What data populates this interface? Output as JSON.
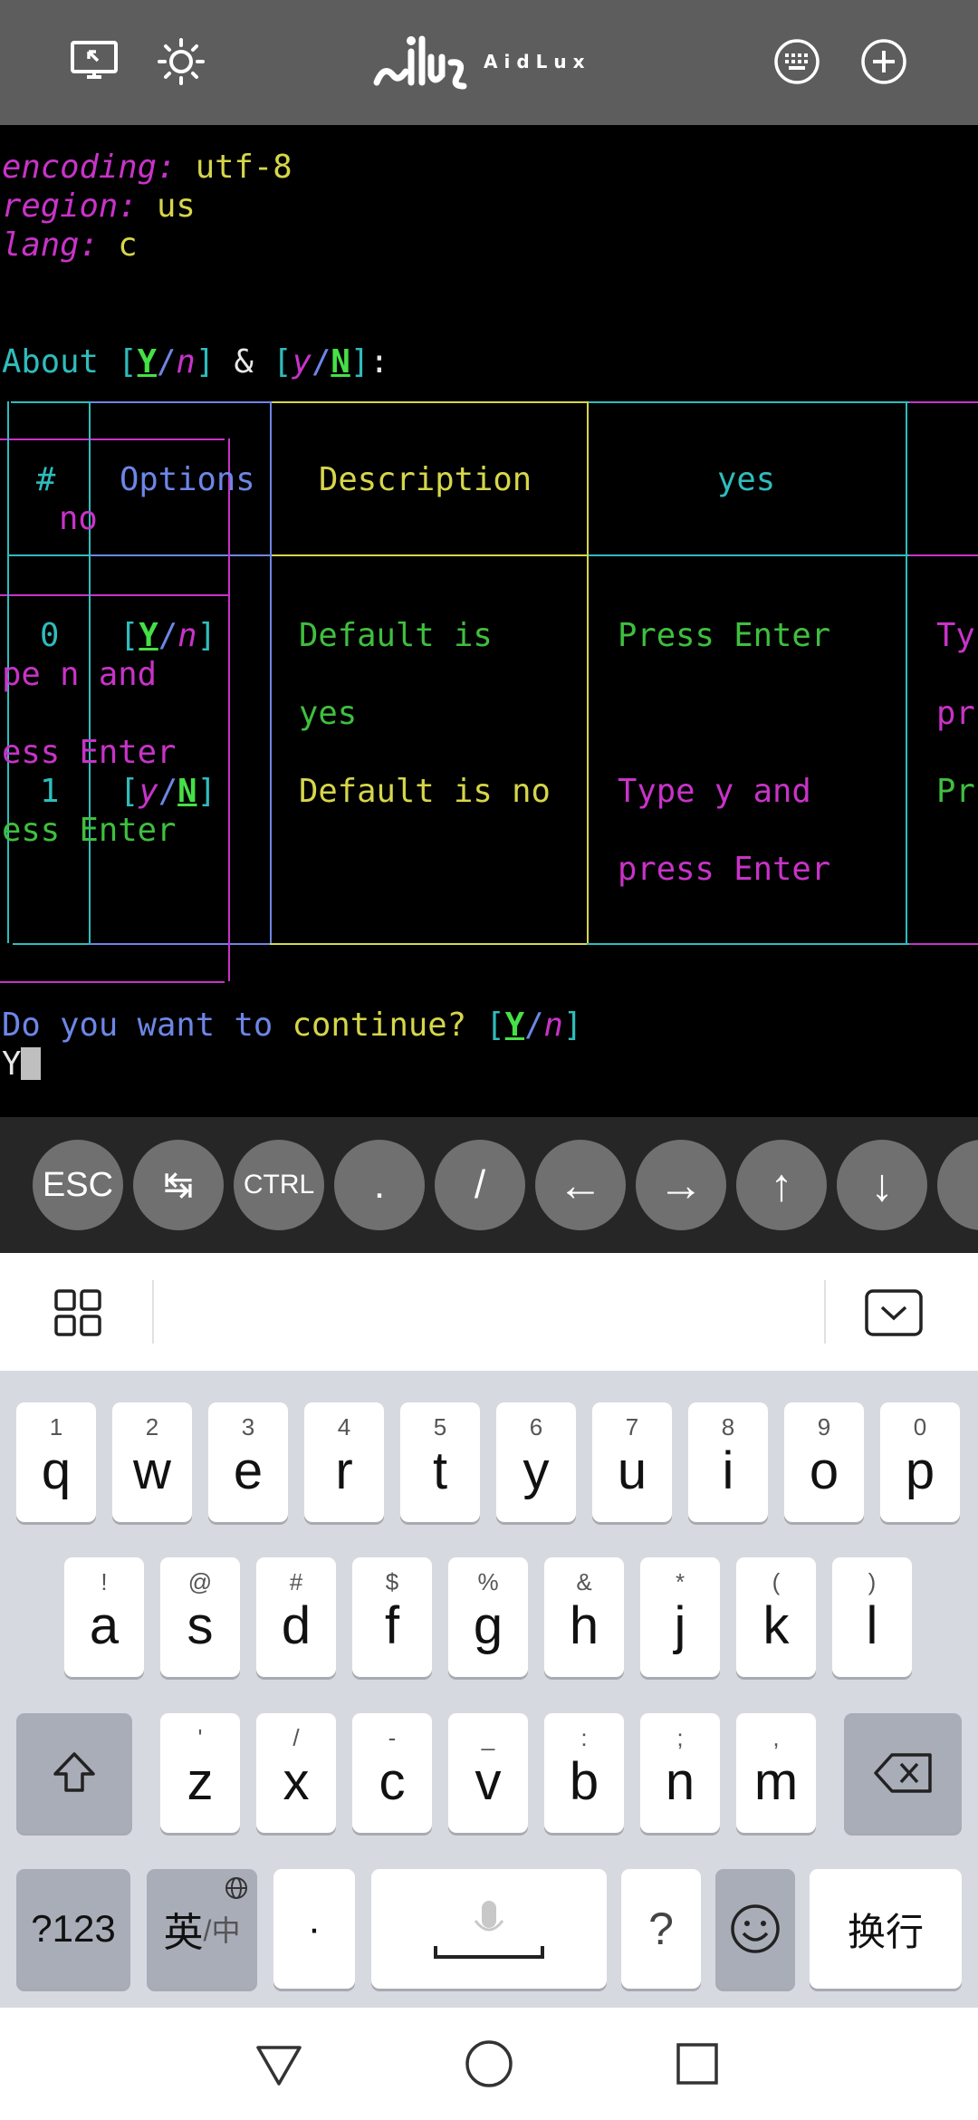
{
  "app": {
    "brand": "AidLux",
    "icons": {
      "screen": "screen-cast-icon",
      "brightness": "brightness-icon",
      "keyboard": "keyboard-icon",
      "add": "add-circle-icon"
    }
  },
  "terminal": {
    "config": [
      {
        "key": "encoding:",
        "value": "utf-8"
      },
      {
        "key": "region:",
        "value": "us"
      },
      {
        "key": "lang:",
        "value": "c"
      }
    ],
    "about": {
      "label": "About ",
      "yes_default": {
        "o": "[",
        "Y": "Y",
        "sep": "/",
        "n": "n",
        "c": "]"
      },
      "amp": " & ",
      "no_default": {
        "o": "[",
        "y": "y",
        "sep": "/",
        "N": "N",
        "c": "]"
      },
      "colon": ":"
    },
    "table": {
      "headers": [
        "#",
        "Options",
        "Description",
        "yes",
        "no"
      ],
      "rows": [
        {
          "num": "0",
          "opt": {
            "o": "[",
            "a": "Y",
            "sep": "/",
            "b": "n",
            "c": "]"
          },
          "desc": [
            "Default is",
            "yes"
          ],
          "yes": [],
          "yes_text": "Press Enter",
          "no_parts": [
            "Ty",
            "pe n and",
            "pr",
            "ess Enter"
          ]
        },
        {
          "num": "1",
          "opt": {
            "o": "[",
            "a": "y",
            "sep": "/",
            "b": "N",
            "c": "]"
          },
          "desc": [
            "Default is no"
          ],
          "yes_text": "Type y and",
          "yes_text2": "press Enter",
          "no_parts": [
            "Pr",
            "ess Enter"
          ]
        }
      ]
    },
    "prompt": {
      "w1": "Do you want to ",
      "w2": "continue? ",
      "o": "[",
      "Y": "Y",
      "sep": "/",
      "n": "n",
      "c": "]"
    },
    "input": "Y"
  },
  "extra_keys": [
    {
      "label": "ESC",
      "name": "esc-key"
    },
    {
      "label": "↹",
      "name": "tab-key"
    },
    {
      "label": "CTRL",
      "name": "ctrl-key"
    },
    {
      "label": ".",
      "name": "period-key"
    },
    {
      "label": "/",
      "name": "slash-key"
    },
    {
      "label": "←",
      "name": "arrow-left-key"
    },
    {
      "label": "→",
      "name": "arrow-right-key"
    },
    {
      "label": "↑",
      "name": "arrow-up-key"
    },
    {
      "label": "↓",
      "name": "arrow-down-key"
    }
  ],
  "keyboard": {
    "row1": [
      {
        "main": "q",
        "sub": "1"
      },
      {
        "main": "w",
        "sub": "2"
      },
      {
        "main": "e",
        "sub": "3"
      },
      {
        "main": "r",
        "sub": "4"
      },
      {
        "main": "t",
        "sub": "5"
      },
      {
        "main": "y",
        "sub": "6"
      },
      {
        "main": "u",
        "sub": "7"
      },
      {
        "main": "i",
        "sub": "8"
      },
      {
        "main": "o",
        "sub": "9"
      },
      {
        "main": "p",
        "sub": "0"
      }
    ],
    "row2": [
      {
        "main": "a",
        "sub": "!"
      },
      {
        "main": "s",
        "sub": "@"
      },
      {
        "main": "d",
        "sub": "#"
      },
      {
        "main": "f",
        "sub": "$"
      },
      {
        "main": "g",
        "sub": "%"
      },
      {
        "main": "h",
        "sub": "&"
      },
      {
        "main": "j",
        "sub": "*"
      },
      {
        "main": "k",
        "sub": "("
      },
      {
        "main": "l",
        "sub": ")"
      }
    ],
    "row3": [
      {
        "main": "z",
        "sub": "'"
      },
      {
        "main": "x",
        "sub": "/"
      },
      {
        "main": "c",
        "sub": "-"
      },
      {
        "main": "v",
        "sub": "_"
      },
      {
        "main": "b",
        "sub": ":"
      },
      {
        "main": "n",
        "sub": ";"
      },
      {
        "main": "m",
        "sub": ","
      }
    ],
    "symbols_label": "?123",
    "lang_label": "英",
    "lang_sub": "/中",
    "dot_label": "·",
    "question_label": "?",
    "enter_label": "换行",
    "icons": {
      "shift": "shift-icon",
      "backspace": "backspace-icon",
      "globe": "globe-icon",
      "mic": "microphone-icon",
      "emoji": "emoji-icon",
      "menu": "menu-grid-icon",
      "collapse": "collapse-keyboard-icon"
    }
  },
  "navbar": {
    "icons": {
      "back": "back-icon",
      "home": "home-icon",
      "recents": "recents-icon"
    }
  },
  "colors": {
    "topbar": "#5d5d5d",
    "terminal_bg": "#000000",
    "magenta": "#c833c8",
    "yellow": "#d6d64a",
    "cyan": "#2fbcbc",
    "blue": "#6d86e6",
    "green": "#3fbf3f",
    "keyboard_bg": "#d6d9e0"
  }
}
